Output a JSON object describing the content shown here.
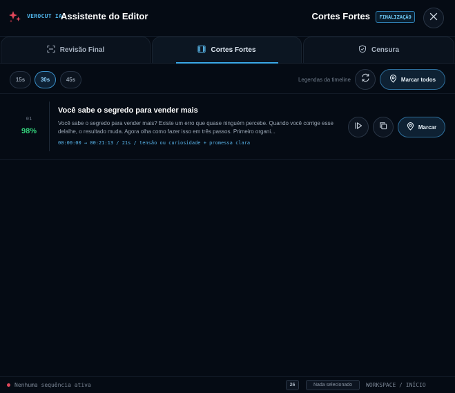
{
  "header": {
    "brand_tag": "VEROCUT IA",
    "brand_title": "Assistente do Editor",
    "mode_title": "Cortes Fortes",
    "mode_badge": "FINALIZAÇÃO",
    "close_icon": "close-icon",
    "brand_icon": "sparkle-icon"
  },
  "tabs": [
    {
      "label": "Revisão Final",
      "icon": "scan-icon",
      "active": false
    },
    {
      "label": "Cortes Fortes",
      "icon": "film-icon",
      "active": true
    },
    {
      "label": "Censura",
      "icon": "shield-icon",
      "active": false
    }
  ],
  "toolbar": {
    "durations": [
      {
        "label": "15s",
        "active": false
      },
      {
        "label": "30s",
        "active": true
      },
      {
        "label": "45s",
        "active": false
      }
    ],
    "captions_label": "Legendas da timeline",
    "refresh_icon": "refresh-icon",
    "mark_all_label": "Marcar todos"
  },
  "clips": [
    {
      "index": "01",
      "score": "98%",
      "title": "Você sabe o segredo para vender mais",
      "description": "Você sabe o segredo para vender mais? Existe um erro que quase ninguém percebe. Quando você corrige esse delalhe, o resultado muda. Agora olha como fazer isso em três passos. Primeiro organi...",
      "meta": "00:00:00 → 00:21:13 / 21s / tensão ou curiosidade + promessa clara",
      "mark_label": "Marcar"
    }
  ],
  "footer": {
    "status": "Nenhuma sequência ativa",
    "count": "26",
    "selection": "Nada selecionado",
    "workspace": "WORKSPACE / INÍCIO"
  },
  "colors": {
    "accent": "#3aa9e8",
    "score": "#33d17a",
    "status_dot": "#e0475a",
    "brand": "#e0475a"
  }
}
